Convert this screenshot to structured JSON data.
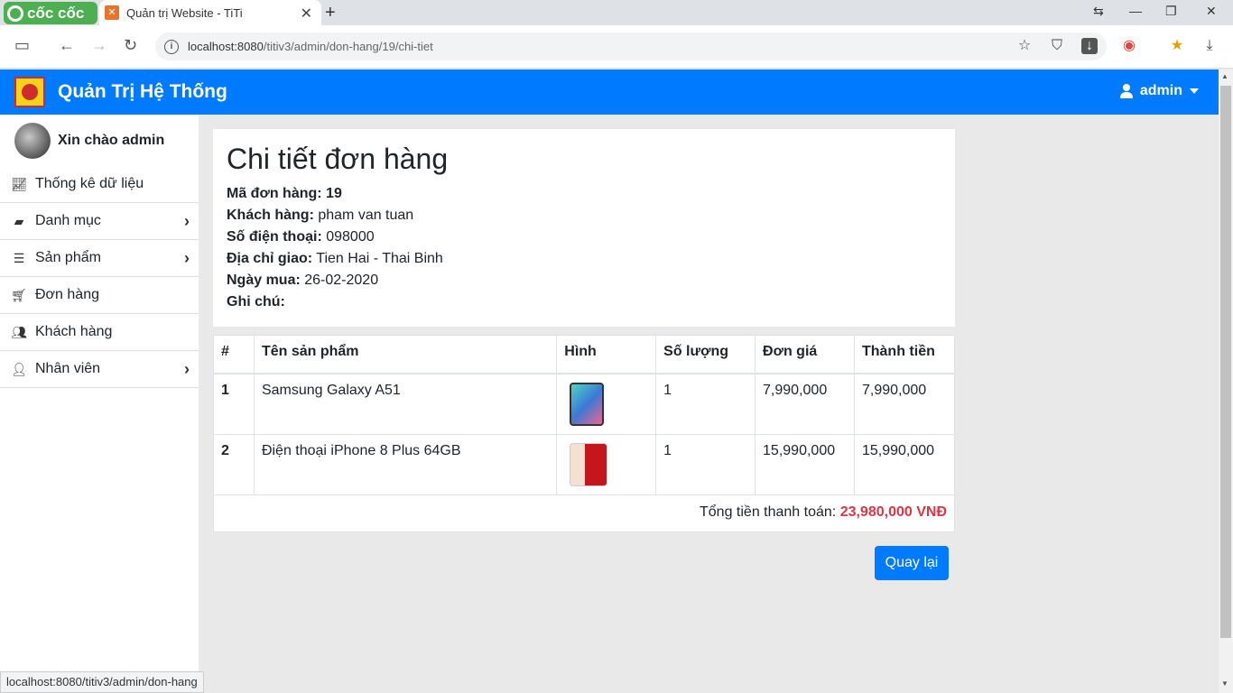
{
  "browser": {
    "name": "cốc cốc",
    "tab_title": "Quản trị Website - TiTi",
    "url_host": "localhost:8080",
    "url_path": "/titiv3/admin/don-hang/19/chi-tiet",
    "status_url": "localhost:8080/titiv3/admin/don-hang"
  },
  "header": {
    "title": "Quản Trị Hệ Thống",
    "user": "admin",
    "accent": "#007bff"
  },
  "sidebar": {
    "greeting": "Xin chào admin",
    "items": [
      {
        "label": "Thống kê dữ liệu",
        "icon": "chart-line-icon",
        "has_submenu": false
      },
      {
        "label": "Danh mục",
        "icon": "folder-open-icon",
        "has_submenu": true
      },
      {
        "label": "Sản phẩm",
        "icon": "database-icon",
        "has_submenu": true
      },
      {
        "label": "Đơn hàng",
        "icon": "cart-icon",
        "has_submenu": false
      },
      {
        "label": "Khách hàng",
        "icon": "users-icon",
        "has_submenu": false
      },
      {
        "label": "Nhân viên",
        "icon": "user-lock-icon",
        "has_submenu": true
      }
    ]
  },
  "order": {
    "heading": "Chi tiết đơn hàng",
    "id_label": "Mã đơn hàng:",
    "id_value": "19",
    "customer_label": "Khách hàng:",
    "customer_value": "pham van tuan",
    "phone_label": "Số điện thoại:",
    "phone_value": "098000",
    "address_label": "Địa chỉ giao:",
    "address_value": "Tien Hai - Thai Binh",
    "date_label": "Ngày mua:",
    "date_value": "26-02-2020",
    "note_label": "Ghi chú:",
    "note_value": ""
  },
  "table": {
    "columns": [
      "#",
      "Tên sản phẩm",
      "Hình",
      "Số lượng",
      "Đơn giá",
      "Thành tiền"
    ],
    "rows": [
      {
        "index": "1",
        "name": "Samsung Galaxy A51",
        "image": "samsung-a51-image",
        "qty": "1",
        "price": "7,990,000",
        "total": "7,990,000"
      },
      {
        "index": "2",
        "name": "Điện thoại iPhone 8 Plus 64GB",
        "image": "iphone-8-plus-image",
        "qty": "1",
        "price": "15,990,000",
        "total": "15,990,000"
      }
    ],
    "total_label": "Tổng tiền thanh toán:",
    "total_value": "23,980,000 VNĐ",
    "total_color": "#dc3545"
  },
  "back_button": "Quay lại"
}
